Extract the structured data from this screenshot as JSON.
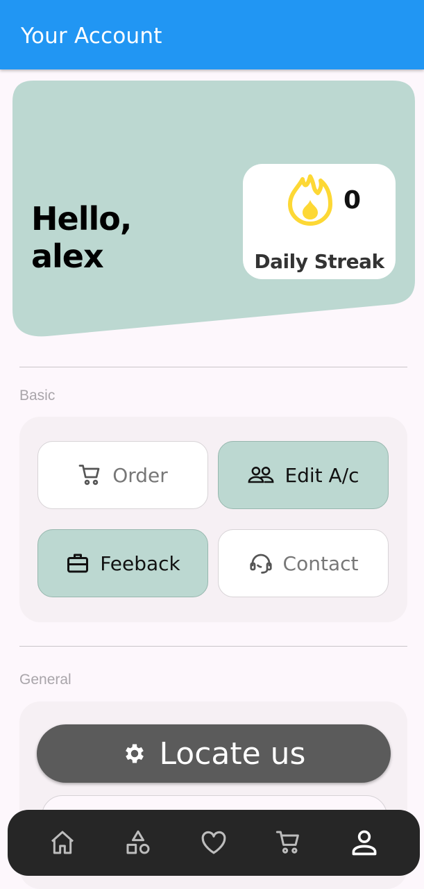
{
  "app_bar": {
    "title": "Your Account"
  },
  "greeting": {
    "line1": "Hello,",
    "line2": "alex"
  },
  "streak": {
    "count": "0",
    "label": "Daily Streak",
    "icon": "flame-icon"
  },
  "sections": {
    "basic": {
      "label": "Basic",
      "tiles": [
        {
          "label": "Order",
          "icon": "cart-icon",
          "style": "plain"
        },
        {
          "label": "Edit A/c",
          "icon": "people-icon",
          "style": "filled"
        },
        {
          "label": "Feeback",
          "icon": "briefcase-icon",
          "style": "filled"
        },
        {
          "label": "Contact",
          "icon": "support-agent-icon",
          "style": "plain"
        }
      ]
    },
    "general": {
      "label": "General",
      "locate_button": {
        "label": "Locate us",
        "icon": "gear-icon"
      }
    }
  },
  "bottom_nav": {
    "items": [
      {
        "icon": "home-icon",
        "active": false
      },
      {
        "icon": "categories-icon",
        "active": false
      },
      {
        "icon": "heart-icon",
        "active": false
      },
      {
        "icon": "cart-icon",
        "active": false
      },
      {
        "icon": "person-icon",
        "active": true
      }
    ]
  },
  "colors": {
    "app_bar": "#2196f3",
    "hero": "#bcd8d1",
    "filled_tile": "#bcd8d1",
    "locate_button": "#5b5b5b",
    "nav_bar": "#262626",
    "flame": "#fdd835"
  }
}
